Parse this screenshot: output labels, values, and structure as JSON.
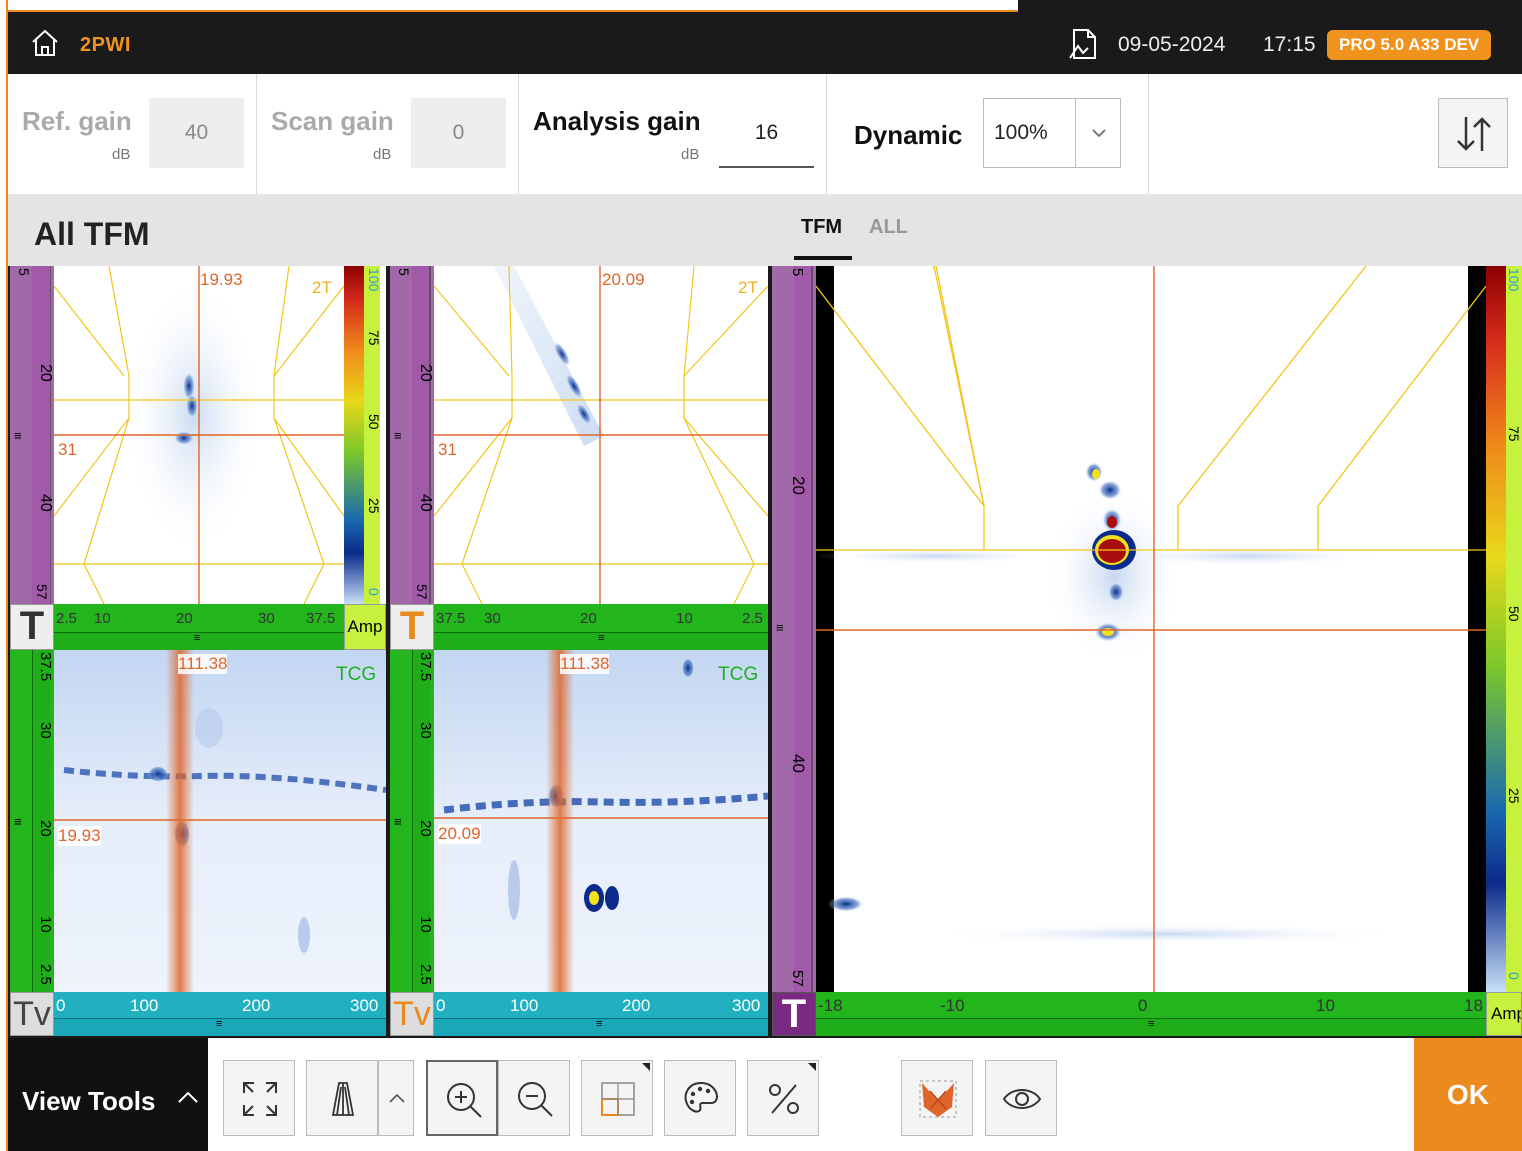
{
  "topbar": {
    "app_name": "2PWI",
    "date": "09-05-2024",
    "time": "17:15",
    "version_badge": "PRO 5.0 A33 DEV"
  },
  "gains": {
    "ref_label": "Ref. gain",
    "ref_unit": "dB",
    "ref_value": "40",
    "scan_label": "Scan gain",
    "scan_unit": "dB",
    "scan_value": "0",
    "analysis_label": "Analysis gain",
    "analysis_unit": "dB",
    "analysis_value": "16",
    "dynamic_label": "Dynamic",
    "dynamic_value": "100%"
  },
  "view": {
    "title": "All TFM",
    "tabs": [
      {
        "label": "TFM",
        "selected": true
      },
      {
        "label": "ALL",
        "selected": false
      }
    ]
  },
  "panes": {
    "tl": {
      "cursor_h": "19.93",
      "cursor_v": "31",
      "mode": "2T",
      "v_ticks": [
        "5",
        "20",
        "40",
        "57"
      ],
      "v_mid": "≡",
      "h_ticks": [
        "2.5",
        "10",
        "20",
        "30",
        "37.5"
      ],
      "h_mid": "≡",
      "view_letter": "T",
      "scale_ticks": [
        "100",
        "75",
        "50",
        "25",
        "0"
      ],
      "scale_label": "Amp"
    },
    "tr": {
      "cursor_h": "20.09",
      "cursor_v": "31",
      "mode": "2T",
      "v_ticks": [
        "5",
        "20",
        "40",
        "57"
      ],
      "v_mid": "≡",
      "h_ticks": [
        "37.5",
        "30",
        "20",
        "10",
        "2.5"
      ],
      "h_mid": "≡",
      "view_letter": "T"
    },
    "bl": {
      "cursor_x": "111.38",
      "cursor_y": "19.93",
      "gain_mode": "TCG",
      "v_ticks": [
        "37.5",
        "30",
        "20",
        "10",
        "2.5"
      ],
      "v_mid": "≡",
      "h_ticks": [
        "0",
        "100",
        "200",
        "300"
      ],
      "h_mid": "≡",
      "view_letter": "Tv"
    },
    "br": {
      "cursor_x": "111.38",
      "cursor_y": "20.09",
      "gain_mode": "TCG",
      "v_ticks": [
        "37.5",
        "30",
        "20",
        "10",
        "2.5"
      ],
      "v_mid": "≡",
      "h_ticks": [
        "0",
        "100",
        "200",
        "300"
      ],
      "h_mid": "≡",
      "view_letter": "Tv"
    },
    "big": {
      "v_ticks": [
        "5",
        "20",
        "40",
        "57"
      ],
      "v_mid": "≡",
      "h_ticks": [
        "-18",
        "-10",
        "0",
        "10",
        "18"
      ],
      "h_mid": "≡",
      "view_letter": "T",
      "scale_ticks": [
        "100",
        "75",
        "50",
        "25",
        "0"
      ],
      "scale_label": "Amp"
    }
  },
  "toolbar": {
    "view_tools_label": "View Tools",
    "buttons": [
      "fullscreen-icon",
      "probe-icon",
      "zoom-in-icon",
      "zoom-out-icon",
      "layout-icon",
      "palette-icon",
      "percent-icon",
      "overlay-icon",
      "eye-icon"
    ],
    "ok_label": "OK"
  },
  "colors": {
    "accent": "#ea8a1f",
    "axis_purple": "#a06aa8",
    "axis_green": "#22b51c",
    "axis_teal": "#20b0c0",
    "cursor": "#e0652a",
    "overlay": "#f2c51c"
  }
}
